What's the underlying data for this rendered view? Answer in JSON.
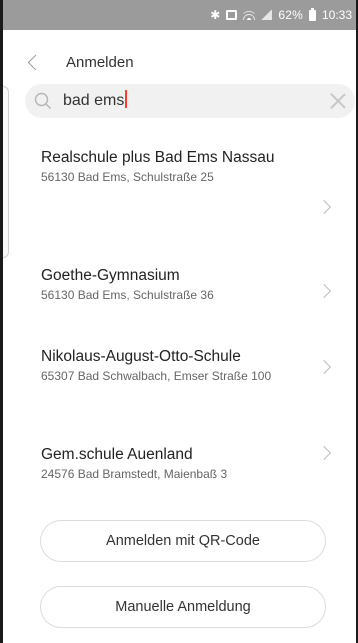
{
  "status_bar": {
    "battery_percent": "62%",
    "time": "10:33",
    "icons": [
      "bluetooth-icon",
      "image-icon",
      "wifi-icon",
      "signal-icon",
      "battery-icon"
    ]
  },
  "header": {
    "title": "Anmelden"
  },
  "search": {
    "value": "bad ems"
  },
  "results": [
    {
      "name": "Realschule plus Bad Ems Nassau",
      "address": "56130 Bad Ems, Schulstraße 25"
    },
    {
      "name": "Goethe-Gymnasium",
      "address": "56130 Bad Ems, Schulstraße 36"
    },
    {
      "name": "Nikolaus-August-Otto-Schule",
      "address": "65307 Bad Schwalbach, Emser Straße 100"
    },
    {
      "name": "Gem.schule Auenland",
      "address": "24576 Bad Bramstedt, Maienbaß 3"
    }
  ],
  "buttons": {
    "qr_label": "Anmelden mit QR-Code",
    "manual_label": "Manuelle Anmeldung"
  },
  "colors": {
    "status_bar_bg": "#9b9b9b",
    "search_bg": "#f1f1f1",
    "caret": "#ff3b30"
  }
}
